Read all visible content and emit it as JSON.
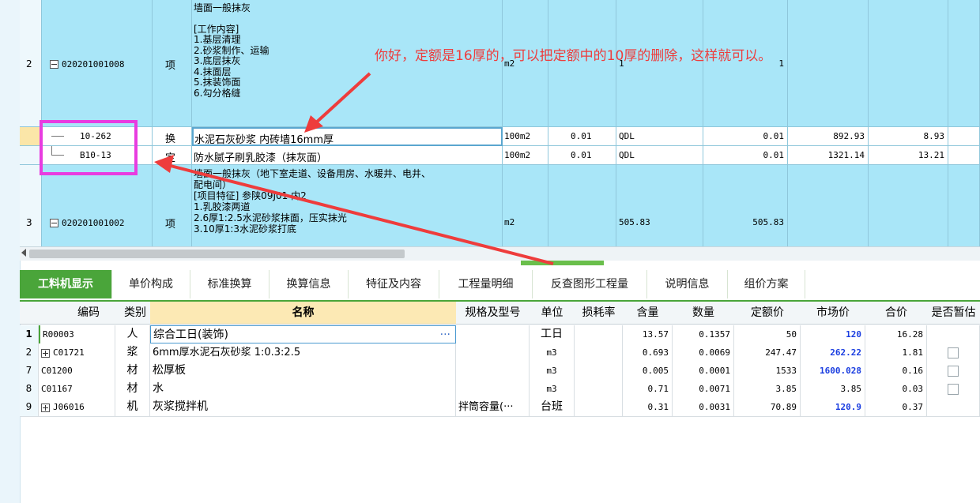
{
  "top_rows": [
    {
      "num": "2",
      "code": "020201001008",
      "type": "项",
      "desc_lines": [
        "墙面一般抹灰",
        "",
        "[工作内容]",
        "1.基层清理",
        "2.砂浆制作、运输",
        "3.底层抹灰",
        "4.抹面层",
        "5.抹装饰面",
        "6.勾分格缝"
      ],
      "unit": "m2",
      "col6": "",
      "col7": "1",
      "col8": "1"
    },
    {
      "num": "",
      "code": "10-262",
      "type": "换",
      "desc": "水泥石灰砂浆 内砖墙16mm厚",
      "unit": "100m2",
      "qty": "0.01",
      "expr": "QDL",
      "qty2": "0.01",
      "price": "892.93",
      "total": "8.93"
    },
    {
      "num": "",
      "code": "B10-13",
      "type": "定",
      "desc": "防水腻子刷乳胶漆（抹灰面）",
      "unit": "100m2",
      "qty": "0.01",
      "expr": "QDL",
      "qty2": "0.01",
      "price": "1321.14",
      "total": "13.21"
    },
    {
      "num": "3",
      "code": "020201001002",
      "type": "项",
      "desc_lines": [
        "墙面一般抹灰（地下室走道、设备用房、水暖井、电井、",
        "配电间）",
        "[项目特征]  参陕09J01 内2",
        "1.乳胶漆两道",
        "2.6厚1:2.5水泥砂浆抹面，压实抹光",
        "3.10厚1:3水泥砂浆打底"
      ],
      "unit": "m2",
      "expr": "505.83",
      "qty2": "505.83"
    }
  ],
  "annotation": "你好，定额是16厚的，可以把定额中的10厚的删除，这样就可以。",
  "tabs": [
    "工料机显示",
    "单价构成",
    "标准换算",
    "换算信息",
    "特征及内容",
    "工程量明细",
    "反查图形工程量",
    "说明信息",
    "组价方案"
  ],
  "bottom_headers": [
    "编码",
    "类别",
    "名称",
    "规格及型号",
    "单位",
    "损耗率",
    "含量",
    "数量",
    "定额价",
    "市场价",
    "合价",
    "是否暂估"
  ],
  "bottom_rows": [
    {
      "idx": "1",
      "code": "R00003",
      "type": "人",
      "name": "综合工日(装饰)",
      "spec": "",
      "unit": "工日",
      "loss": "",
      "content": "13.57",
      "qty": "0.1357",
      "quota": "50",
      "market": "120",
      "total": "16.28",
      "expand": false,
      "check": false,
      "ellipsis": "···"
    },
    {
      "idx": "2",
      "code": "C01721",
      "type": "浆",
      "name": "6mm厚水泥石灰砂浆 1:0.3:2.5",
      "spec": "",
      "unit": "m3",
      "loss": "",
      "content": "0.693",
      "qty": "0.0069",
      "quota": "247.47",
      "market": "262.22",
      "total": "1.81",
      "expand": true,
      "check": true
    },
    {
      "idx": "7",
      "code": "C01200",
      "type": "材",
      "name": "松厚板",
      "spec": "",
      "unit": "m3",
      "loss": "",
      "content": "0.005",
      "qty": "0.0001",
      "quota": "1533",
      "market": "1600.028",
      "total": "0.16",
      "expand": false,
      "check": true
    },
    {
      "idx": "8",
      "code": "C01167",
      "type": "材",
      "name": "水",
      "spec": "",
      "unit": "m3",
      "loss": "",
      "content": "0.71",
      "qty": "0.0071",
      "quota": "3.85",
      "market": "3.85",
      "total": "0.03",
      "expand": false,
      "check": true
    },
    {
      "idx": "9",
      "code": "J06016",
      "type": "机",
      "name": "灰浆搅拌机",
      "spec": "拌筒容量(···",
      "unit": "台班",
      "loss": "",
      "content": "0.31",
      "qty": "0.0031",
      "quota": "70.89",
      "market": "120.9",
      "total": "0.37",
      "expand": true,
      "check": false
    }
  ],
  "colors": {
    "accent_green": "#4aa53a",
    "row_cyan": "#a9e6f8",
    "annotation_red": "#ee3c3c",
    "highlight_magenta": "#e83ce0",
    "market_blue": "#1a3de0"
  }
}
